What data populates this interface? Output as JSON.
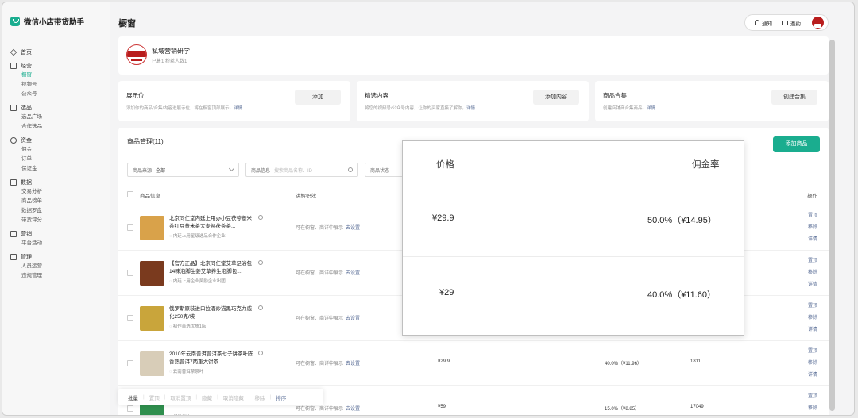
{
  "app": {
    "name": "微信小店带货助手"
  },
  "sidebar": {
    "groups": [
      {
        "label": "首页",
        "icon": "home-icon",
        "items": []
      },
      {
        "label": "经营",
        "icon": "shop-icon",
        "items": [
          "橱窗",
          "视频号",
          "公众号"
        ]
      },
      {
        "label": "选品",
        "icon": "bag-icon",
        "items": [
          "选品广场",
          "合作选品"
        ]
      },
      {
        "label": "资金",
        "icon": "yen-icon",
        "items": [
          "佣金",
          "订单",
          "保证金"
        ]
      },
      {
        "label": "数据",
        "icon": "chart-icon",
        "items": [
          "交易分析",
          "商品榜单",
          "数据罗盘",
          "带货评分"
        ]
      },
      {
        "label": "营销",
        "icon": "gift-icon",
        "items": [
          "平台活动"
        ]
      },
      {
        "label": "管理",
        "icon": "grid-icon",
        "items": [
          "人员运营",
          "违规管理"
        ]
      }
    ],
    "active_item": "橱窗"
  },
  "header": {
    "title": "橱窗",
    "notify": "通知",
    "mail": "邀约"
  },
  "shop": {
    "name": "私域营销研学",
    "stats": "已售1  粉丝人数1"
  },
  "features": [
    {
      "title": "展示位",
      "desc": "添加你的商品/合集/内容进展示位，将在橱窗顶部展示。",
      "link": "详情",
      "button": "添加"
    },
    {
      "title": "精选内容",
      "desc": "将您的视频号/公众号内容，让你的买家直接了解你。",
      "link": "详情",
      "button": "添加内容"
    },
    {
      "title": "商品合集",
      "desc": "创建店铺商合集商品。",
      "link": "详情",
      "button": "创建合集"
    }
  ],
  "goods": {
    "title": "商品管理(11)",
    "add_button": "添加商品",
    "filters": {
      "source_label": "商品来源",
      "source_value": "全部",
      "search_label": "商品信息",
      "search_placeholder": "搜索商品名称、ID",
      "status_label": "商品状态"
    },
    "columns": {
      "info": "商品信息",
      "explain": "讲解职效",
      "ops": "操作"
    },
    "rows": [
      {
        "title": "北京同仁堂内廷上用办小豆茯苓薏米茶红豆薏米茶大麦熟茯苓茶...",
        "tag": "内廷上用星级选品合作企业",
        "state": "可在橱窗、商详中展示",
        "set": "去设置",
        "price": "",
        "commission": "",
        "sales": "",
        "thumb": "#d9a24a"
      },
      {
        "title": "【官方正品】北京同仁堂艾草足浴包14味泡脚生姜艾草养生泡脚包...",
        "tag": "内廷上用企业奖励企业出团",
        "state": "可在橱窗、商详中展示",
        "set": "去设置",
        "price": "",
        "commission": "",
        "sales": "",
        "thumb": "#7a3a1e"
      },
      {
        "title": "俄罗斯原装进口拉酒炒猫黑巧克力威化250克/袋",
        "tag": "初作首选优质1店",
        "state": "可在橱窗、商详中展示",
        "set": "去设置",
        "price": "",
        "commission": "",
        "sales": "",
        "thumb": "#c9a53b"
      },
      {
        "title": "2010年云南普洱普洱茶七子饼茶叶陈香熟普洱7两重大饼茶",
        "tag": "云南普洱茶茶叶",
        "state": "可在橱窗、商详中展示",
        "set": "去设置",
        "price": "¥29.9",
        "commission": "40.0%（¥11.96）",
        "sales": "1811",
        "thumb": "#d8cdb8"
      },
      {
        "title": "",
        "tag": "超级供物",
        "state": "可在橱窗、商详中展示",
        "set": "去设置",
        "price": "¥59",
        "commission": "15.0%（¥8.85）",
        "sales": "17049",
        "thumb": "#2f8f4e"
      }
    ],
    "row_ops": [
      "置顶",
      "移除",
      "详情"
    ]
  },
  "batch_bar": [
    "批量",
    "置顶",
    "取消置顶",
    "隐藏",
    "取消隐藏",
    "移除",
    "排序"
  ],
  "zoom": {
    "col_price": "价格",
    "col_commission": "佣金率",
    "rows": [
      {
        "price": "¥29.9",
        "commission": "50.0%（¥14.95）"
      },
      {
        "price": "¥29",
        "commission": "40.0%（¥11.60）"
      }
    ]
  }
}
